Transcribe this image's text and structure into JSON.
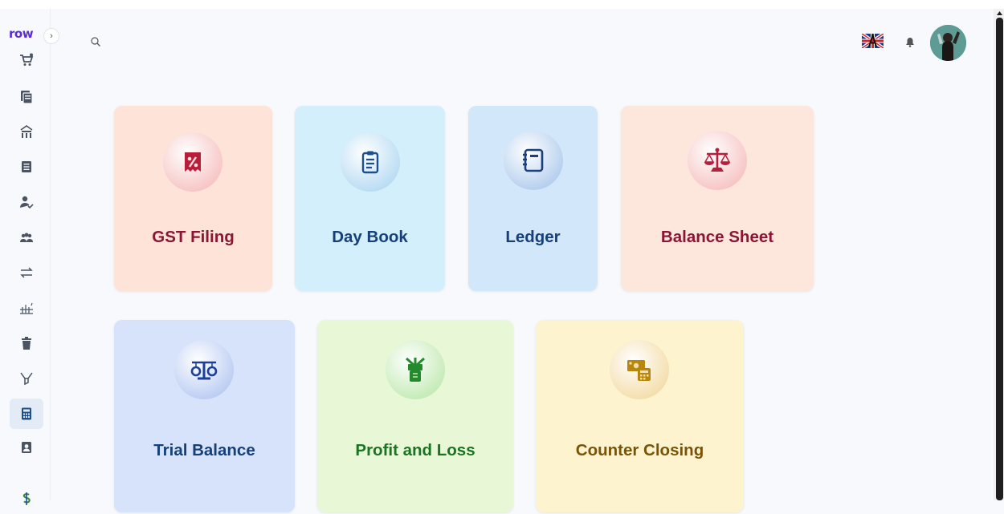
{
  "app": {
    "logo_text": "row"
  },
  "sidebar": {
    "items": [
      {
        "name": "cart",
        "icon": "cart-icon"
      },
      {
        "name": "documents",
        "icon": "documents-icon"
      },
      {
        "name": "store",
        "icon": "store-icon"
      },
      {
        "name": "list",
        "icon": "list-icon"
      },
      {
        "name": "user-check",
        "icon": "user-check-icon"
      },
      {
        "name": "users",
        "icon": "users-icon"
      },
      {
        "name": "transfer",
        "icon": "transfer-icon"
      },
      {
        "name": "growth",
        "icon": "growth-icon"
      },
      {
        "name": "trash",
        "icon": "trash-icon"
      },
      {
        "name": "filter",
        "icon": "filter-icon"
      },
      {
        "name": "calculator",
        "icon": "calculator-icon",
        "active": true
      },
      {
        "name": "contact",
        "icon": "contact-icon"
      },
      {
        "name": "dollar",
        "icon": "dollar-icon"
      }
    ]
  },
  "header": {
    "language_flag": "uk-flag-icon",
    "notifications": "bell-icon",
    "profile": "avatar"
  },
  "cards": [
    {
      "key": "gst",
      "title": "GST Filing",
      "icon": "tax-percent-icon",
      "bg": "#fde3d8",
      "circle": "#f7c5c5",
      "color": "#8c1535",
      "icon_color": "#b81e3a"
    },
    {
      "key": "daybook",
      "title": "Day Book",
      "icon": "clipboard-icon",
      "bg": "#d3effb",
      "circle": "#b9dcf3",
      "color": "#16407a",
      "icon_color": "#1c4f8f"
    },
    {
      "key": "ledger",
      "title": "Ledger",
      "icon": "ledger-book-icon",
      "bg": "#d3e7fb",
      "circle": "#b5cfee",
      "color": "#16407a",
      "icon_color": "#1c3f7d"
    },
    {
      "key": "balancesheet",
      "title": "Balance Sheet",
      "icon": "scale-icon",
      "bg": "#fde6db",
      "circle": "#f7c5c5",
      "color": "#8c1535",
      "icon_color": "#b81e3a"
    },
    {
      "key": "trialbalance",
      "title": "Trial Balance",
      "icon": "balance-icon",
      "bg": "#d6e3fb",
      "circle": "#bccdf3",
      "color": "#16407a",
      "icon_color": "#1c3f9a"
    },
    {
      "key": "pnl",
      "title": "Profit and Loss",
      "icon": "money-icon",
      "bg": "#e8f8d6",
      "circle": "#c5ebb7",
      "color": "#1b7423",
      "icon_color": "#238a2d"
    },
    {
      "key": "counter",
      "title": "Counter Closing",
      "icon": "cash-register-icon",
      "bg": "#fdf3cf",
      "circle": "#f4deac",
      "color": "#7a5307",
      "icon_color": "#b8860b"
    }
  ]
}
